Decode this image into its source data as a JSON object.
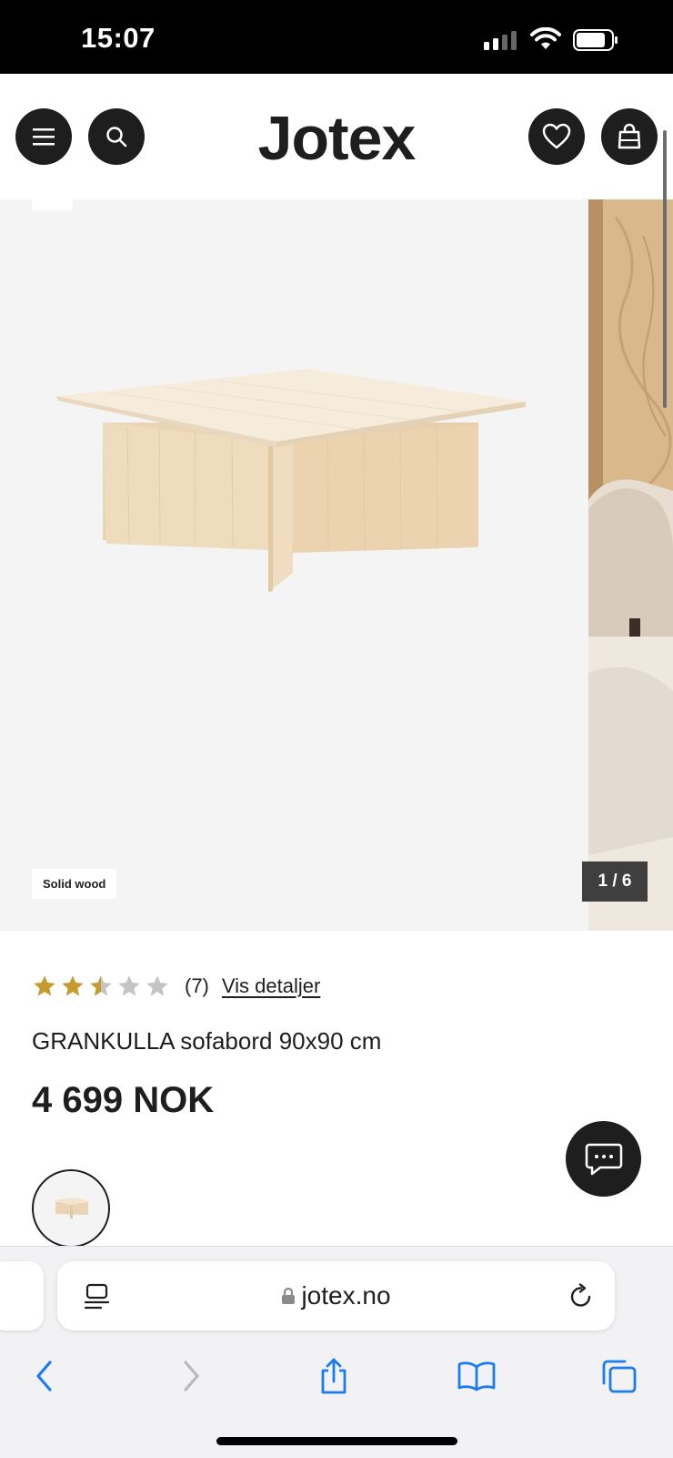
{
  "status_bar": {
    "time": "15:07"
  },
  "header": {
    "logo": "Jotex"
  },
  "gallery": {
    "badge": "Solid wood",
    "counter": "1 / 6"
  },
  "product": {
    "rating": 2.5,
    "review_count": "(7)",
    "details_link": "Vis detaljer",
    "title": "GRANKULLA sofabord 90x90 cm",
    "price": "4 699 NOK"
  },
  "browser": {
    "url": "jotex.no"
  },
  "colors": {
    "dark": "#1e1e1e",
    "star": "#c79a2e",
    "star_empty": "#c4c4c4",
    "ios_blue": "#1a7cf0"
  }
}
